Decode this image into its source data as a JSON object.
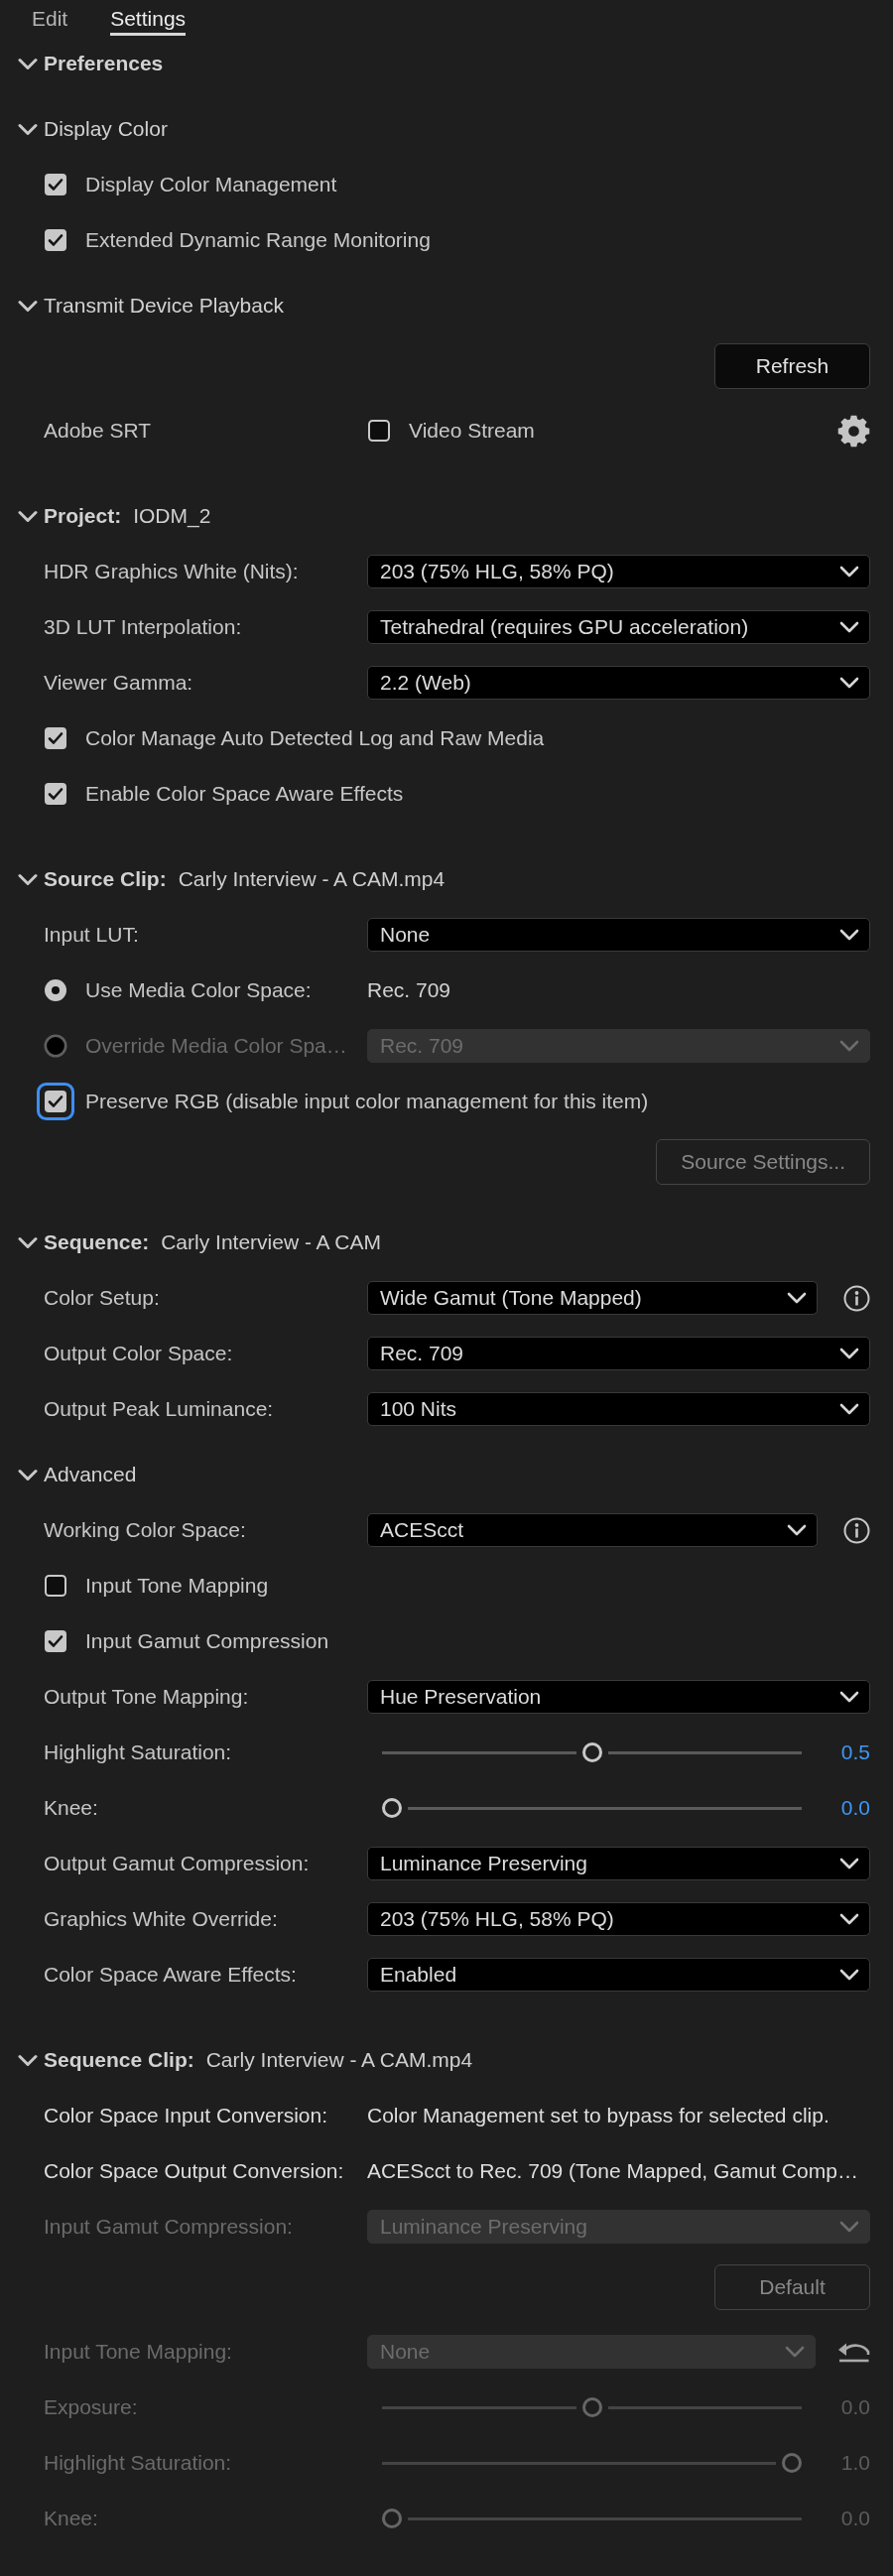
{
  "tabs": [
    {
      "label": "Edit",
      "selected": false
    },
    {
      "label": "Settings",
      "selected": true
    }
  ],
  "items": [
    {
      "kind": "section",
      "title": "Preferences",
      "expanded": true
    },
    {
      "kind": "subsection",
      "title": "Display Color",
      "expanded": true
    },
    {
      "kind": "checkbox",
      "label": "Display Color Management",
      "checked": true,
      "focused": false
    },
    {
      "kind": "checkbox",
      "label": "Extended Dynamic Range Monitoring",
      "checked": true,
      "focused": false
    },
    {
      "kind": "subsection",
      "title": "Transmit Device Playback",
      "expanded": true
    },
    {
      "kind": "button",
      "label": "Refresh",
      "disabled": false
    },
    {
      "kind": "device",
      "label": "Adobe SRT",
      "option": "Video Stream",
      "checked": false
    },
    {
      "kind": "section",
      "title": "Project:",
      "value": "IODM_2",
      "expanded": true
    },
    {
      "kind": "dropdown",
      "label": "HDR Graphics White (Nits):",
      "value": "203 (75% HLG, 58% PQ)",
      "disabled": false
    },
    {
      "kind": "dropdown",
      "label": "3D LUT Interpolation:",
      "value": "Tetrahedral (requires GPU acceleration)",
      "disabled": false
    },
    {
      "kind": "dropdown",
      "label": "Viewer Gamma:",
      "value": "2.2 (Web)",
      "disabled": false
    },
    {
      "kind": "checkbox",
      "label": "Color Manage Auto Detected Log and Raw Media",
      "checked": true,
      "focused": false
    },
    {
      "kind": "checkbox",
      "label": "Enable Color Space Aware Effects",
      "checked": true,
      "focused": false
    },
    {
      "kind": "section",
      "title": "Source Clip:",
      "value": "Carly Interview - A CAM.mp4",
      "expanded": true
    },
    {
      "kind": "dropdown",
      "label": "Input LUT:",
      "value": "None",
      "disabled": false
    },
    {
      "kind": "radio",
      "label": "Use Media Color Space:",
      "value": "Rec. 709",
      "selected": true,
      "disabled": false
    },
    {
      "kind": "radio_dropdown",
      "label": "Override Media Color Spa…",
      "value": "Rec. 709",
      "selected": false,
      "disabled": true
    },
    {
      "kind": "checkbox",
      "label": "Preserve RGB (disable input color management for this item)",
      "checked": true,
      "focused": true
    },
    {
      "kind": "button",
      "label": "Source Settings...",
      "disabled": true
    },
    {
      "kind": "section",
      "title": "Sequence:",
      "value": "Carly Interview - A CAM",
      "expanded": true
    },
    {
      "kind": "dropdown",
      "label": "Color Setup:",
      "value": "Wide Gamut (Tone Mapped)",
      "disabled": false,
      "info": true
    },
    {
      "kind": "dropdown",
      "label": "Output Color Space:",
      "value": "Rec. 709",
      "disabled": false
    },
    {
      "kind": "dropdown",
      "label": "Output Peak Luminance:",
      "value": "100 Nits",
      "disabled": false
    },
    {
      "kind": "subsection",
      "title": "Advanced",
      "expanded": true
    },
    {
      "kind": "dropdown",
      "label": "Working Color Space:",
      "value": "ACEScct",
      "disabled": false,
      "info": true
    },
    {
      "kind": "checkbox",
      "label": "Input Tone Mapping",
      "checked": false,
      "focused": false
    },
    {
      "kind": "checkbox",
      "label": "Input Gamut Compression",
      "checked": true,
      "focused": false
    },
    {
      "kind": "dropdown",
      "label": "Output Tone Mapping:",
      "value": "Hue Preservation",
      "disabled": false
    },
    {
      "kind": "slider",
      "label": "Highlight Saturation:",
      "level": 0.5,
      "reading": "0.5",
      "disabled": false
    },
    {
      "kind": "slider",
      "label": "Knee:",
      "level": 0,
      "reading": "0.0",
      "disabled": false
    },
    {
      "kind": "dropdown",
      "label": "Output Gamut Compression:",
      "value": "Luminance Preserving",
      "disabled": false
    },
    {
      "kind": "dropdown",
      "label": "Graphics White Override:",
      "value": "203 (75% HLG, 58% PQ)",
      "disabled": false
    },
    {
      "kind": "dropdown",
      "label": "Color Space Aware Effects:",
      "value": "Enabled",
      "disabled": false
    },
    {
      "kind": "section",
      "title": "Sequence Clip:",
      "value": "Carly Interview - A CAM.mp4",
      "expanded": true
    },
    {
      "kind": "readout",
      "label": "Color Space Input Conversion:",
      "value": "Color Management set to bypass for selected clip."
    },
    {
      "kind": "readout",
      "label": "Color Space Output Conversion:",
      "value": "ACEScct to Rec. 709 (Tone Mapped, Gamut Comp…"
    },
    {
      "kind": "dropdown",
      "label": "Input Gamut Compression:",
      "value": "Luminance Preserving",
      "disabled": true
    },
    {
      "kind": "button",
      "label": "Default",
      "disabled": true
    },
    {
      "kind": "dropdown",
      "label": "Input Tone Mapping:",
      "value": "None",
      "disabled": true,
      "reset": true
    },
    {
      "kind": "slider",
      "label": "Exposure:",
      "level": 0.5,
      "reading": "0.0",
      "disabled": true
    },
    {
      "kind": "slider",
      "label": "Highlight Saturation:",
      "level": 1,
      "reading": "1.0",
      "disabled": true
    },
    {
      "kind": "slider",
      "label": "Knee:",
      "level": 0,
      "reading": "0.0",
      "disabled": true
    }
  ]
}
